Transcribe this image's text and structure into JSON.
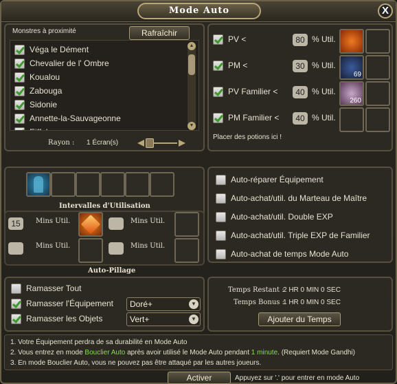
{
  "window": {
    "title": "Mode Auto",
    "close_label": "X"
  },
  "monsters": {
    "title": "Monstres à proximité",
    "refresh_label": "Rafraîchir",
    "items": [
      {
        "label": "Véga le Dément",
        "checked": true
      },
      {
        "label": "Chevalier de l' Ombre",
        "checked": true
      },
      {
        "label": "Koualou",
        "checked": true
      },
      {
        "label": "Zabouga",
        "checked": true
      },
      {
        "label": "Sidonie",
        "checked": true
      },
      {
        "label": "Annette-la-Sauvageonne",
        "checked": true
      },
      {
        "label": "Eiffel",
        "checked": true
      }
    ],
    "range_label": "Rayon :",
    "range_value": "1 Écran(s)"
  },
  "potions": {
    "rows": [
      {
        "label": "PV <",
        "value": "80",
        "unit": "% Util.",
        "checked": true,
        "item_count": ""
      },
      {
        "label": "PM <",
        "value": "30",
        "unit": "% Util.",
        "checked": true,
        "item_count": "69"
      },
      {
        "label": "PV Familier <",
        "value": "40",
        "unit": "% Util.",
        "checked": true,
        "item_count": "260"
      },
      {
        "label": "PM Familier <",
        "value": "40",
        "unit": "% Util.",
        "checked": true,
        "item_count": ""
      }
    ],
    "hint": "Placer des potions ici !"
  },
  "skills": {
    "interval_title": "Intervalles d'Utilisation",
    "rows": [
      {
        "left_value": "15",
        "left_label": "Mins Util.",
        "right_value": "",
        "right_label": "Mins Util."
      },
      {
        "left_value": "",
        "left_label": "Mins Util.",
        "right_value": "",
        "right_label": "Mins Util."
      }
    ],
    "pillage_title": "Auto-Pillage"
  },
  "auto_options": [
    {
      "label": "Auto-réparer Équipement",
      "checked": false
    },
    {
      "label": "Auto-achat/util. du Marteau de Maître",
      "checked": false
    },
    {
      "label": "Auto-achat/util. Double EXP",
      "checked": false
    },
    {
      "label": "Auto-achat/util. Triple EXP de Familier",
      "checked": false
    },
    {
      "label": "Auto-achat de temps Mode Auto",
      "checked": false
    }
  ],
  "loot": {
    "items": [
      {
        "label": "Ramasser Tout",
        "checked": false,
        "select": ""
      },
      {
        "label": "Ramasser l'Équipement",
        "checked": true,
        "select": "Doré+"
      },
      {
        "label": "Ramasser les Objets",
        "checked": true,
        "select": "Vert+"
      }
    ]
  },
  "time": {
    "remaining_label": "Temps Restant :",
    "remaining_value": "2 HR 0 MIN 0 SEC",
    "bonus_label": "Temps Bonus :",
    "bonus_value": "1 HR 0 MIN 0 SEC",
    "add_label": "Ajouter du Temps"
  },
  "notes": {
    "line1": "1. Votre Équipement perdra de sa durabilité en Mode Auto",
    "line2_a": "2. Vous entrez en mode ",
    "line2_b": "Bouclier Auto",
    "line2_c": " après avoir utilisé le Mode Auto pendant ",
    "line2_d": "1 minute",
    "line2_e": ". (Requiert Mode Gandhi)",
    "line3": "3. En mode Bouclier Auto, vous ne pouvez pas être attaqué par les autres joueurs.",
    "highlight_color": "#7fe04a"
  },
  "footer": {
    "activate_label": "Activer",
    "hint": "Appuyez sur '.' pour entrer en mode Auto"
  }
}
